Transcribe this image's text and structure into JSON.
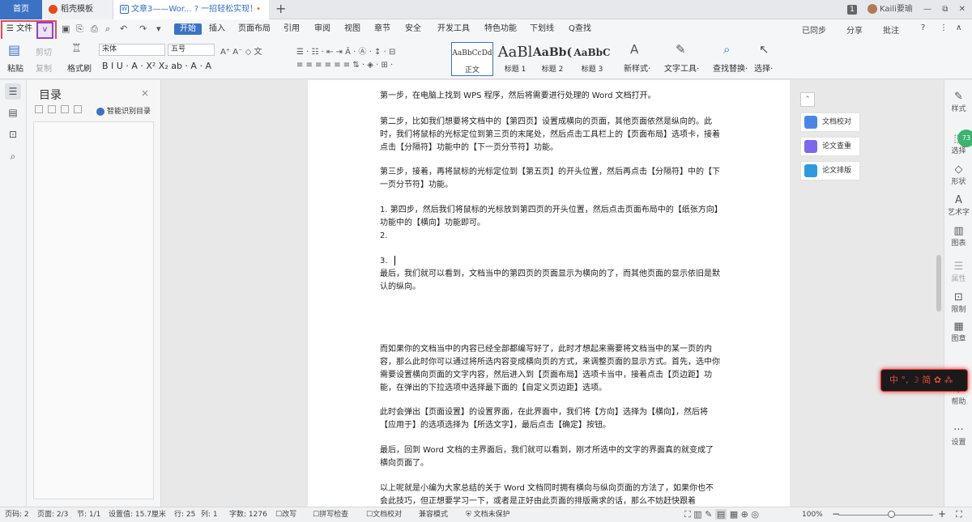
{
  "tabs": {
    "home": "首页",
    "template": "稻壳模板",
    "doc": "文章3——Wor... ? 一招轻松实现！",
    "doc_icon": "W",
    "doc_modified": "•",
    "new_tab": "+"
  },
  "window": {
    "badge": "1",
    "user": "Kaili要瑜",
    "minimize": "—",
    "restore": "⧉",
    "close": "✕"
  },
  "menubar": {
    "file": "文件",
    "dropdown": "v",
    "quick_icons": [
      "save-icon",
      "format-painter-icon",
      "print-icon",
      "print-preview-icon",
      "undo-icon",
      "redo-icon",
      "more-icon"
    ],
    "quick_glyphs": [
      "▣",
      "⎘",
      "⎙",
      "⌕",
      "↶",
      "↷",
      "▾"
    ],
    "items": [
      "开始",
      "插入",
      "页面布局",
      "引用",
      "审阅",
      "视图",
      "章节",
      "安全",
      "开发工具",
      "特色功能",
      "下划线",
      "Q查找"
    ],
    "right": [
      "已同步",
      "分享",
      "批注",
      "?",
      "⋮",
      "∧"
    ]
  },
  "ribbon": {
    "paste": "粘贴",
    "cut": "剪切",
    "copy": "复制",
    "format_painter": "格式刷",
    "font_name": "宋体",
    "font_size": "五号",
    "font_row1": "A⁺ A⁻ ◇ 文",
    "font_row2": "B I U · A · X² X₂ ab · A · A",
    "para_row1": "☰ · ☷ · ⇤ ⇥ Ā · Ⓐ · ↕ · ⊟",
    "para_row2": "≡ ≡ ≡ ≡ ≡ ≡ ⇅ · ◈ · ⊞ ·",
    "styles": [
      {
        "preview": "AaBbCcDd",
        "label": "正文"
      },
      {
        "preview": "AaBl",
        "label": "标题 1"
      },
      {
        "preview": "AaBb(",
        "label": "标题 2"
      },
      {
        "preview": "AaBbC",
        "label": "标题 3"
      }
    ],
    "new_style": "新样式·",
    "text_tools": "文字工具·",
    "find_replace": "查找替换·",
    "select": "选择·"
  },
  "toc": {
    "title": "目录",
    "close": "×",
    "smart": "智能识别目录"
  },
  "document": {
    "paragraphs": [
      "第一步，在电脑上找到 WPS 程序，然后将需要进行处理的 Word 文档打开。",
      "第二步，比如我们想要将文档中的【第四页】设置成横向的页面，其他页面依然是纵向的。此时，我们将鼠标的光标定位到第三页的末尾处，然后点击工具栏上的【页面布局】选项卡，接着点击【分隔符】功能中的【下一页分节符】功能。",
      "第三步，接着，再将鼠标的光标定位到【第五页】的开头位置，然后再点击【分隔符】中的【下一页分节符】功能。",
      "1.  第四步，然后我们将鼠标的光标放到第四页的开头位置，然后点击页面布局中的【纸张方向】功能中的【横向】功能即可。",
      "2.",
      "3.",
      "最后，我们就可以看到，文档当中的第四页的页面显示为横向的了，而其他页面的显示依旧是默认的纵向。",
      "而如果你的文档当中的内容已经全部都编写好了，此时才想起来需要将文档当中的某一页的内容，那么此时你可以通过将所选内容变成横向页的方式，来调整页面的显示方式。首先，选中你需要设置横向页面的文字内容，然后进入到【页面布局】选项卡当中，接着点击【页边距】功能，在弹出的下拉选项中选择最下面的【自定义页边距】选项。",
      "此时会弹出【页面设置】的设置界面，在此界面中，我们将【方向】选择为【横向】，然后将【应用于】的选项选择为【所选文字】，最后点击【确定】按钮。",
      "最后，回到 Word 文档的主界面后，我们就可以看到，刚才所选中的文字的界面真的就变成了横向页面了。",
      "以上呢就是小编为大家总结的关于 Word 文档同时拥有横向与纵向页面的方法了，如果你也不会此技巧，但正想要学习一下，或者是正好由此页面的排版需求的话，那么不妨赶快跟着"
    ]
  },
  "float_panel": {
    "collapse": "⌃",
    "buttons": [
      {
        "label": "文档校对",
        "color": "#4a86e8"
      },
      {
        "label": "论文查重",
        "color": "#7b68ee"
      },
      {
        "label": "论文排版",
        "color": "#2e9ae0"
      }
    ]
  },
  "right_sidebar": {
    "items": [
      "样式",
      "选择",
      "形状",
      "艺术字",
      "图表",
      "属性",
      "限制",
      "图章",
      "帮助",
      "设置"
    ],
    "glyphs": [
      "✎",
      "⬚",
      "◇",
      "A",
      "▥",
      "☰",
      "⊡",
      "▦",
      "?",
      "···"
    ],
    "green_badge": "73"
  },
  "ime": {
    "text": "中 °, ☽ 简 ✿ ⁂"
  },
  "statusbar": {
    "page_num": "页码: 2",
    "pages": "页面: 2/3",
    "section": "节: 1/1",
    "setting": "设置值: 15.7厘米",
    "row": "行: 25",
    "col": "列: 1",
    "words": "字数: 1276",
    "revise": "改写",
    "spell": "拼写检查",
    "proof": "文档校对",
    "compat": "兼容模式",
    "unprotected": "文档未保护",
    "zoom": "100%",
    "zoom_minus": "−",
    "zoom_plus": "+",
    "zoom_level": 1.0
  }
}
